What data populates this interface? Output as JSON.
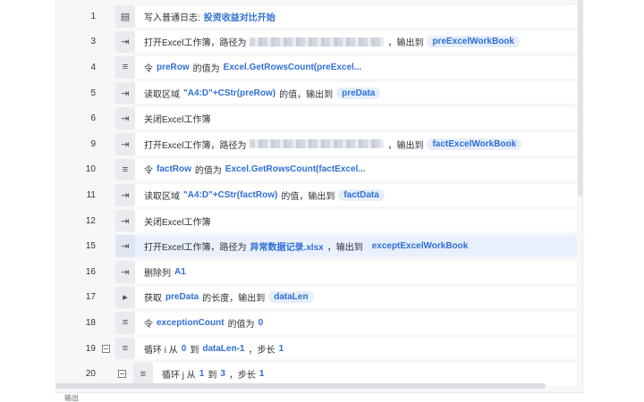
{
  "rows": [
    {
      "line": "1",
      "icon": "log-icon",
      "glyph": "▤",
      "parts": [
        {
          "t": "写入普通日志: "
        },
        {
          "t": "投资收益对比开始",
          "c": "kw"
        }
      ]
    },
    {
      "line": "3",
      "icon": "excel-open-icon",
      "glyph": "⇥",
      "parts": [
        {
          "t": "打开Excel工作簿，路径为"
        },
        {
          "blur": true
        },
        {
          "t": "，输出到"
        },
        {
          "t": "preExcelWorkBook",
          "c": "tag"
        }
      ]
    },
    {
      "line": "4",
      "icon": "assign-icon",
      "glyph": "≡",
      "parts": [
        {
          "t": "令"
        },
        {
          "t": "preRow",
          "c": "kw"
        },
        {
          "t": "的值为"
        },
        {
          "t": "Excel.GetRowsCount(preExcel...",
          "c": "kw"
        }
      ]
    },
    {
      "line": "5",
      "icon": "read-range-icon",
      "glyph": "⇥",
      "parts": [
        {
          "t": "读取区域"
        },
        {
          "t": "\"A4:D\"+CStr(preRow)",
          "c": "kw"
        },
        {
          "t": "的值，输出到"
        },
        {
          "t": "preData",
          "c": "tag"
        }
      ]
    },
    {
      "line": "6",
      "icon": "excel-close-icon",
      "glyph": "⇥",
      "parts": [
        {
          "t": "关闭Excel工作簿"
        }
      ]
    },
    {
      "line": "9",
      "icon": "excel-open-icon",
      "glyph": "⇥",
      "parts": [
        {
          "t": "打开Excel工作簿，路径为"
        },
        {
          "blur": true
        },
        {
          "t": "，输出到"
        },
        {
          "t": "factExcelWorkBook",
          "c": "tag"
        }
      ]
    },
    {
      "line": "10",
      "icon": "assign-icon",
      "glyph": "≡",
      "parts": [
        {
          "t": "令"
        },
        {
          "t": "factRow",
          "c": "kw"
        },
        {
          "t": "的值为"
        },
        {
          "t": "Excel.GetRowsCount(factExcel...",
          "c": "kw"
        }
      ]
    },
    {
      "line": "11",
      "icon": "read-range-icon",
      "glyph": "⇥",
      "parts": [
        {
          "t": "读取区域"
        },
        {
          "t": "\"A4:D\"+CStr(factRow)",
          "c": "kw"
        },
        {
          "t": "的值，输出到"
        },
        {
          "t": "factData",
          "c": "tag"
        }
      ]
    },
    {
      "line": "12",
      "icon": "excel-close-icon",
      "glyph": "⇥",
      "parts": [
        {
          "t": "关闭Excel工作簿"
        }
      ]
    },
    {
      "line": "15",
      "icon": "excel-open-icon",
      "glyph": "⇥",
      "selected": true,
      "parts": [
        {
          "t": "打开Excel工作簿，路径为"
        },
        {
          "t": "异常数据记录.xlsx",
          "c": "kw"
        },
        {
          "t": "，输出到"
        },
        {
          "t": "exceptExcelWorkBook",
          "c": "tag"
        }
      ]
    },
    {
      "line": "16",
      "icon": "delete-column-icon",
      "glyph": "⇥",
      "parts": [
        {
          "t": "删除列"
        },
        {
          "t": "A1",
          "c": "kw"
        }
      ]
    },
    {
      "line": "17",
      "icon": "length-icon",
      "glyph": "▸",
      "parts": [
        {
          "t": "获取"
        },
        {
          "t": "preData",
          "c": "kw"
        },
        {
          "t": "的长度，输出到"
        },
        {
          "t": "dataLen",
          "c": "tag"
        }
      ]
    },
    {
      "line": "18",
      "icon": "assign-icon",
      "glyph": "≡",
      "parts": [
        {
          "t": "令"
        },
        {
          "t": "exceptionCount",
          "c": "kw"
        },
        {
          "t": "的值为"
        },
        {
          "t": "0",
          "c": "kw"
        }
      ]
    },
    {
      "line": "19",
      "icon": "loop-icon",
      "glyph": "≡",
      "fold": true,
      "parts": [
        {
          "t": "循环 i 从"
        },
        {
          "t": "0",
          "c": "kw"
        },
        {
          "t": "到"
        },
        {
          "t": "dataLen-1",
          "c": "kw"
        },
        {
          "t": "，步长"
        },
        {
          "t": "1",
          "c": "kw"
        }
      ]
    },
    {
      "line": "20",
      "icon": "loop-icon",
      "glyph": "≡",
      "fold": true,
      "indent": true,
      "parts": [
        {
          "t": "循环 j 从"
        },
        {
          "t": "1",
          "c": "kw"
        },
        {
          "t": "到"
        },
        {
          "t": "3",
          "c": "kw"
        },
        {
          "t": "，步长"
        },
        {
          "t": "1",
          "c": "kw"
        }
      ]
    }
  ],
  "output_tab": "输出"
}
